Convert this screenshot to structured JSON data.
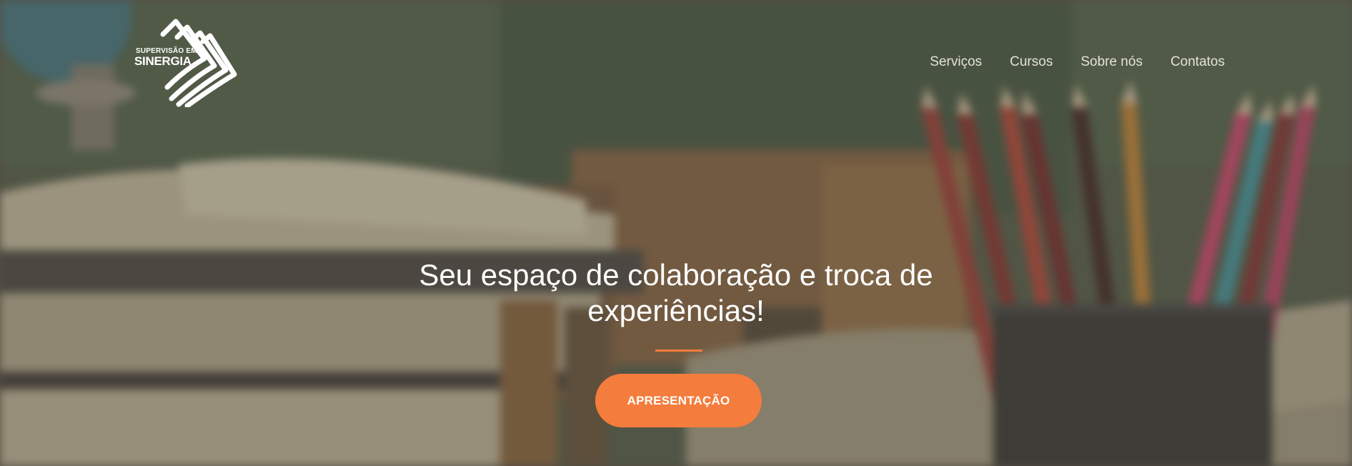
{
  "logo": {
    "line1": "SUPERVISÃO EM",
    "line2": "SINERGIA"
  },
  "nav": {
    "items": [
      {
        "label": "Serviços"
      },
      {
        "label": "Cursos"
      },
      {
        "label": "Sobre nós"
      },
      {
        "label": "Contatos"
      }
    ]
  },
  "hero": {
    "headline": "Seu espaço de colaboração e troca de experiências!",
    "cta_label": "APRESENTAÇÃO"
  },
  "colors": {
    "accent": "#f47c3c",
    "text": "#ffffff",
    "nav_text": "#e4e1dc"
  }
}
